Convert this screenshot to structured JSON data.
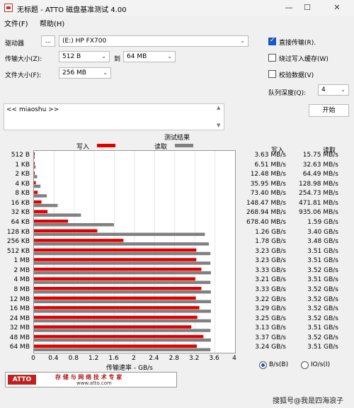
{
  "window": {
    "title": "无标题 - ATTO 磁盘基准测试 4.00",
    "min": "—",
    "max": "☐",
    "close": "✕"
  },
  "menu": {
    "file": "文件(F)",
    "help": "帮助(H)"
  },
  "drive": {
    "label": "驱动器",
    "browse": "...",
    "value": "(E:) HP FX700"
  },
  "transfer": {
    "label": "传输大小(Z):",
    "from": "512 B",
    "to_label": "到",
    "to": "64 MB"
  },
  "filesize": {
    "label": "文件大小(F):",
    "value": "256 MB"
  },
  "options": {
    "direct_io": {
      "label": "直接传输(R).",
      "checked": true
    },
    "bypass_cache": {
      "label": "绕过写入缓存(W)",
      "checked": false
    },
    "verify": {
      "label": "校验数据(V)",
      "checked": false
    },
    "queue_label": "队列深度(Q):",
    "queue_value": "4",
    "start": "开始"
  },
  "description": "<< miaoshu >>",
  "legend": {
    "title": "测试结果",
    "write": "写入",
    "read": "读取"
  },
  "results_header": {
    "write": "写入",
    "read": "读取"
  },
  "axis": {
    "label": "传输速率 - GB/s",
    "ticks": [
      "0",
      "0.4",
      "0.8",
      "1.2",
      "1.6",
      "2",
      "2.4",
      "2.8",
      "3.2",
      "3.6",
      "4"
    ]
  },
  "colors": {
    "write": "#e00000",
    "read": "#808080"
  },
  "chart_data": {
    "type": "bar",
    "categories": [
      "512 B",
      "1 KB",
      "2 KB",
      "4 KB",
      "8 KB",
      "16 KB",
      "32 KB",
      "64 KB",
      "128 KB",
      "256 KB",
      "512 KB",
      "1 MB",
      "2 MB",
      "4 MB",
      "8 MB",
      "12 MB",
      "16 MB",
      "24 MB",
      "32 MB",
      "48 MB",
      "64 MB"
    ],
    "xlabel": "传输速率 - GB/s",
    "xlim": [
      0,
      4
    ],
    "series": [
      {
        "name": "写入",
        "values": [
          0.00363,
          0.00651,
          0.01248,
          0.03595,
          0.0734,
          0.14847,
          0.26894,
          0.6784,
          1.26,
          1.78,
          3.23,
          3.23,
          3.33,
          3.21,
          3.33,
          3.22,
          3.29,
          3.25,
          3.13,
          3.37,
          3.24
        ]
      },
      {
        "name": "读取",
        "values": [
          0.01575,
          0.03263,
          0.06449,
          0.12898,
          0.25473,
          0.47181,
          0.93506,
          1.59,
          3.4,
          3.48,
          3.51,
          3.51,
          3.52,
          3.51,
          3.52,
          3.52,
          3.52,
          3.52,
          3.51,
          3.52,
          3.51
        ]
      }
    ],
    "write_text": [
      "3.63 MB/s",
      "6.51 MB/s",
      "12.48 MB/s",
      "35.95 MB/s",
      "73.40 MB/s",
      "148.47 MB/s",
      "268.94 MB/s",
      "678.40 MB/s",
      "1.26 GB/s",
      "1.78 GB/s",
      "3.23 GB/s",
      "3.23 GB/s",
      "3.33 GB/s",
      "3.21 GB/s",
      "3.33 GB/s",
      "3.22 GB/s",
      "3.29 GB/s",
      "3.25 GB/s",
      "3.13 GB/s",
      "3.37 GB/s",
      "3.24 GB/s"
    ],
    "read_text": [
      "15.75 MB/s",
      "32.63 MB/s",
      "64.49 MB/s",
      "128.98 MB/s",
      "254.73 MB/s",
      "471.81 MB/s",
      "935.06 MB/s",
      "1.59 GB/s",
      "3.40 GB/s",
      "3.48 GB/s",
      "3.51 GB/s",
      "3.51 GB/s",
      "3.52 GB/s",
      "3.51 GB/s",
      "3.52 GB/s",
      "3.52 GB/s",
      "3.52 GB/s",
      "3.52 GB/s",
      "3.51 GB/s",
      "3.52 GB/s",
      "3.51 GB/s"
    ]
  },
  "units": {
    "bytes": "B/s(B)",
    "io": "IO/s(I)",
    "selected": "bytes"
  },
  "banner": {
    "logo": "ATTO",
    "slogan": "存 储 与 网 络 技 术 专 家",
    "url": "www.atto.com"
  },
  "watermark": "搜狐号@我是四海浪子"
}
